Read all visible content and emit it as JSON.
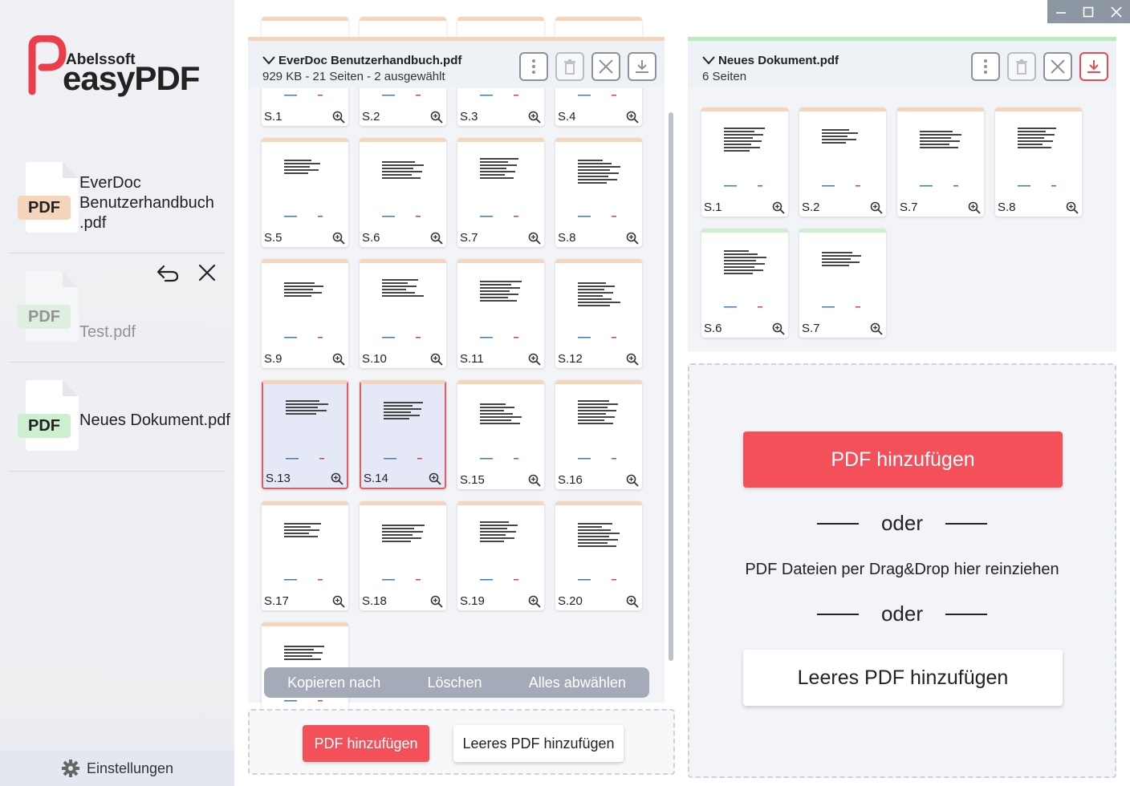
{
  "sidebar": {
    "logo": {
      "brand_small": "Abelssoft",
      "brand_big": "easyPDF"
    },
    "files": [
      {
        "badge": "PDF",
        "name": "EverDoc Benutzerhandbuch .pdf",
        "badge_color": "#f6d5bd"
      },
      {
        "badge": "PDF",
        "name": "Test.pdf",
        "badge_color": "#ccefcf",
        "faded": true
      },
      {
        "badge": "PDF",
        "name": "Neues Dokument.pdf",
        "badge_color": "#ccefcf"
      }
    ],
    "settings_label": "Einstellungen"
  },
  "left_panel": {
    "title": "EverDoc Benutzerhandbuch.pdf",
    "subtitle": "929 KB - 21 Seiten - 2 ausgewählt",
    "accent": "#f6d5bd",
    "pages": [
      "S.1",
      "S.2",
      "S.3",
      "S.4",
      "S.5",
      "S.6",
      "S.7",
      "S.8",
      "S.9",
      "S.10",
      "S.11",
      "S.12",
      "S.13",
      "S.14",
      "S.15",
      "S.16",
      "S.17",
      "S.18",
      "S.19",
      "S.20"
    ],
    "selected": [
      "S.13",
      "S.14"
    ],
    "selection_bar": {
      "copy": "Kopieren nach",
      "delete": "Löschen",
      "deselect": "Alles abwählen"
    },
    "add_pdf": "PDF hinzufügen",
    "add_empty": "Leeres PDF hinzufügen"
  },
  "right_panel": {
    "title": "Neues Dokument.pdf",
    "subtitle": "6 Seiten",
    "accent": "#b9ebc2",
    "pages": [
      "S.1",
      "S.2",
      "S.7",
      "S.8",
      "S.6",
      "S.7"
    ],
    "dropzone": {
      "add_pdf": "PDF hinzufügen",
      "or1": "oder",
      "drag_text": "PDF Dateien per Drag&Drop hier reinziehen",
      "or2": "oder",
      "add_empty": "Leeres PDF hinzufügen"
    }
  },
  "colors": {
    "brand_red": "#f4505a",
    "orange_tag": "#f6d5bd",
    "green_tag": "#ccefcf"
  }
}
